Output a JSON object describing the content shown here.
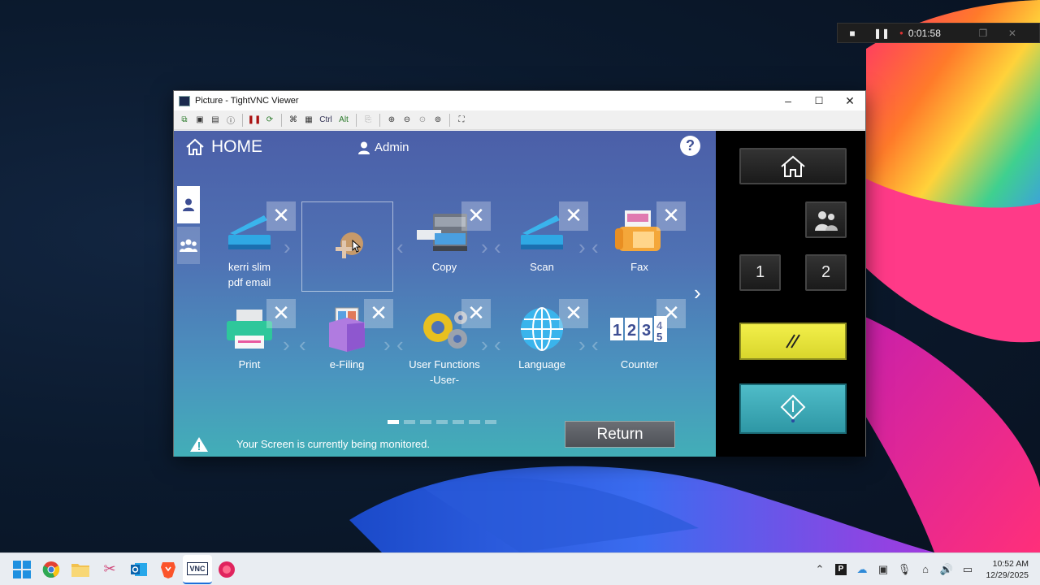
{
  "recorder": {
    "stop_icon": "stop-icon",
    "pause_icon": "pause-icon",
    "timer": "0:01:58",
    "restore_icon": "restore-icon",
    "close_icon": "close-icon"
  },
  "window": {
    "title": "Picture - TightVNC Viewer",
    "min": "–",
    "max": "☐",
    "close": "✕"
  },
  "toolbar": {
    "ctrl": "Ctrl",
    "alt": "Alt"
  },
  "panel": {
    "home_label": "HOME",
    "user": "Admin",
    "help": "?",
    "apps": [
      {
        "label": "kerri slim\npdf email",
        "icon": "scanner-icon"
      },
      {
        "label": "",
        "icon": "add-shortcut-icon"
      },
      {
        "label": "Copy",
        "icon": "copier-icon"
      },
      {
        "label": "Scan",
        "icon": "scanner-icon"
      },
      {
        "label": "Fax",
        "icon": "fax-icon"
      },
      {
        "label": "Print",
        "icon": "printer-icon"
      },
      {
        "label": "e-Filing",
        "icon": "efiling-box-icon"
      },
      {
        "label": "User Functions\n-User-",
        "icon": "gears-icon"
      },
      {
        "label": "Language",
        "icon": "globe-icon"
      },
      {
        "label": "Counter",
        "icon": "counter-icon"
      }
    ],
    "page_indicator": {
      "pages": 7,
      "current": 1
    },
    "return_label": "Return",
    "monitor_msg": "Your Screen is currently being monitored."
  },
  "hardware": {
    "btn1": "1",
    "btn2": "2"
  },
  "taskbar": {
    "time": "10:52 AM",
    "date": "12/29/2025"
  },
  "colors": {
    "clear_button": "#e4e23a",
    "start_button": "#3aa8b5",
    "panel_top": "#4b5fa8",
    "panel_bottom": "#42aeb7"
  }
}
